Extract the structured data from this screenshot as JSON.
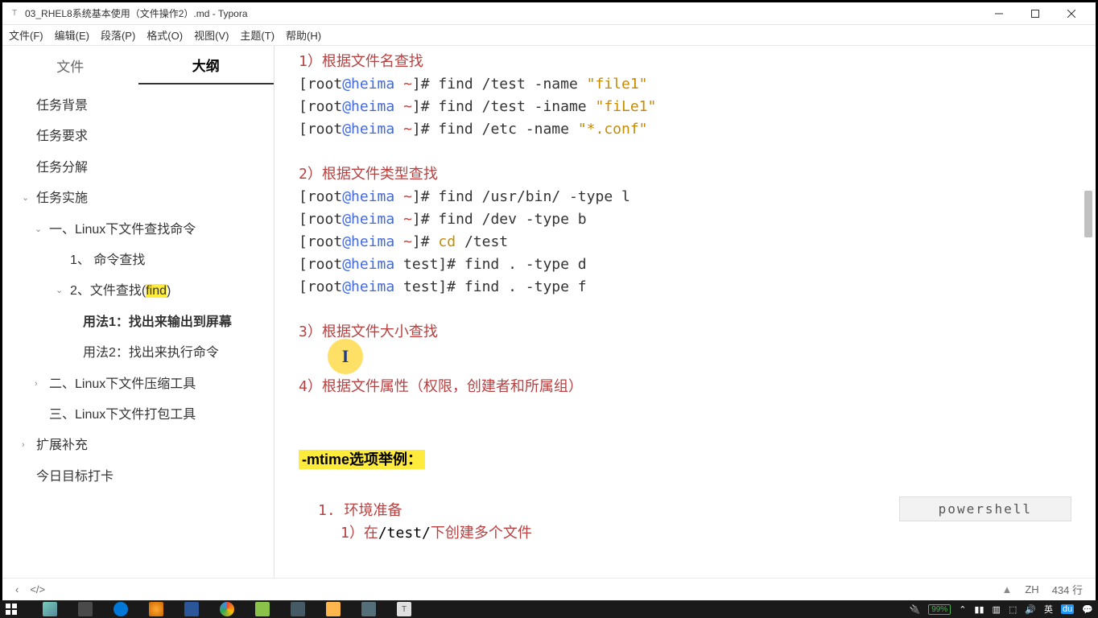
{
  "window": {
    "title": "03_RHEL8系统基本使用（文件操作2）.md - Typora"
  },
  "menu": {
    "file": "文件(F)",
    "edit": "编辑(E)",
    "paragraph": "段落(P)",
    "format": "格式(O)",
    "view": "视图(V)",
    "theme": "主题(T)",
    "help": "帮助(H)"
  },
  "sidebar": {
    "tabs": {
      "file": "文件",
      "outline": "大纲"
    },
    "items": [
      {
        "label": "任务背景",
        "lv": 0
      },
      {
        "label": "任务要求",
        "lv": 0
      },
      {
        "label": "任务分解",
        "lv": 0
      },
      {
        "label": "任务实施",
        "lv": 0,
        "chev": "⌄"
      },
      {
        "label": "一、Linux下文件查找命令",
        "lv": 1,
        "chev": "⌄"
      },
      {
        "label": "1、 命令查找",
        "lv": 2
      },
      {
        "label_pre": "2、文件查找(",
        "label_hl": "find",
        "label_post": ")",
        "lv": 2,
        "chev": "⌄"
      },
      {
        "label": "用法1：找出来输出到屏幕",
        "lv": 3,
        "bold": true
      },
      {
        "label": "用法2：找出来执行命令",
        "lv": 3
      },
      {
        "label": "二、Linux下文件压缩工具",
        "lv": 1,
        "chev": "›"
      },
      {
        "label": "三、Linux下文件打包工具",
        "lv": 1
      },
      {
        "label": "扩展补充",
        "lv": 0,
        "chev": "›"
      },
      {
        "label": "今日目标打卡",
        "lv": 0
      }
    ]
  },
  "content": {
    "block1": {
      "h1": "1）根据文件名查找",
      "lines": [
        {
          "prompt": "[root@heima ~]# ",
          "cmd": "find /test -name ",
          "str": "\"file1\""
        },
        {
          "prompt": "[root@heima ~]# ",
          "cmd": "find /test -iname ",
          "str": "\"fiLe1\""
        },
        {
          "prompt": "[root@heima ~]# ",
          "cmd": "find /etc -name ",
          "str": "\"*.conf\""
        }
      ],
      "h2": "2）根据文件类型查找",
      "lines2": [
        {
          "prompt": "[root@heima ~]# ",
          "cmd": "find /usr/bin/ -type l"
        },
        {
          "prompt": "[root@heima ~]# ",
          "cmd": "find /dev -type b"
        },
        {
          "prompt": "[root@heima ~]# ",
          "cmd2": "cd",
          "rest": " /test"
        },
        {
          "prompt": "[root@heima test]# ",
          "cmd": "find . -type d"
        },
        {
          "prompt": "[root@heima test]# ",
          "cmd": "find . -type f"
        }
      ],
      "h3": "3）根据文件大小查找",
      "h4": "4）根据文件属性（权限，创建者和所属组）"
    },
    "section_label": "-mtime选项举例：",
    "lang_badge": "powershell",
    "list": {
      "n1": "1. ",
      "t1": "环境准备",
      "n2": "1）",
      "t2_a": "在",
      "t2_b": "/test/",
      "t2_c": "下创建多个文件"
    }
  },
  "statusbar": {
    "lang": "ZH",
    "lines": "434 行"
  },
  "tray": {
    "battery": "99%",
    "ime": "英"
  }
}
